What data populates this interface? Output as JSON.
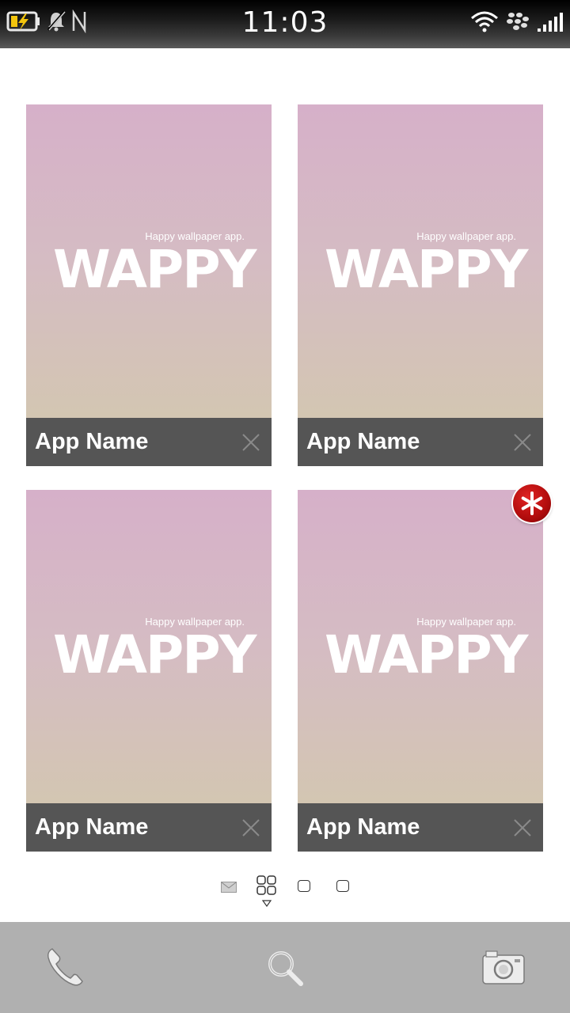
{
  "status_bar": {
    "time": "11:03",
    "left_icons": [
      "battery-charging-icon",
      "notifications-muted-icon",
      "nfc-icon"
    ],
    "right_icons": [
      "wifi-icon",
      "blackberry-icon",
      "signal-icon"
    ]
  },
  "cards": [
    {
      "tagline": "Happy wallpaper app.",
      "logo": "WAPPY",
      "name": "App Name"
    },
    {
      "tagline": "Happy wallpaper app.",
      "logo": "WAPPY",
      "name": "App Name"
    },
    {
      "tagline": "Happy wallpaper app.",
      "logo": "WAPPY",
      "name": "App Name"
    },
    {
      "tagline": "Happy wallpaper app.",
      "logo": "WAPPY",
      "name": "App Name"
    }
  ],
  "pager": {
    "items": [
      "hub-icon",
      "app-grid-icon",
      "page-icon",
      "page-icon"
    ],
    "active_index": 1
  },
  "dock": {
    "items": [
      "phone-icon",
      "search-icon",
      "camera-icon"
    ]
  },
  "colors": {
    "card_footer": "#555555",
    "preview_top": "#d6b0c9",
    "preview_bottom": "#d3c6b2",
    "dock": "#b0b0b0",
    "badge": "#c01515",
    "charging": "#f2c40d"
  }
}
